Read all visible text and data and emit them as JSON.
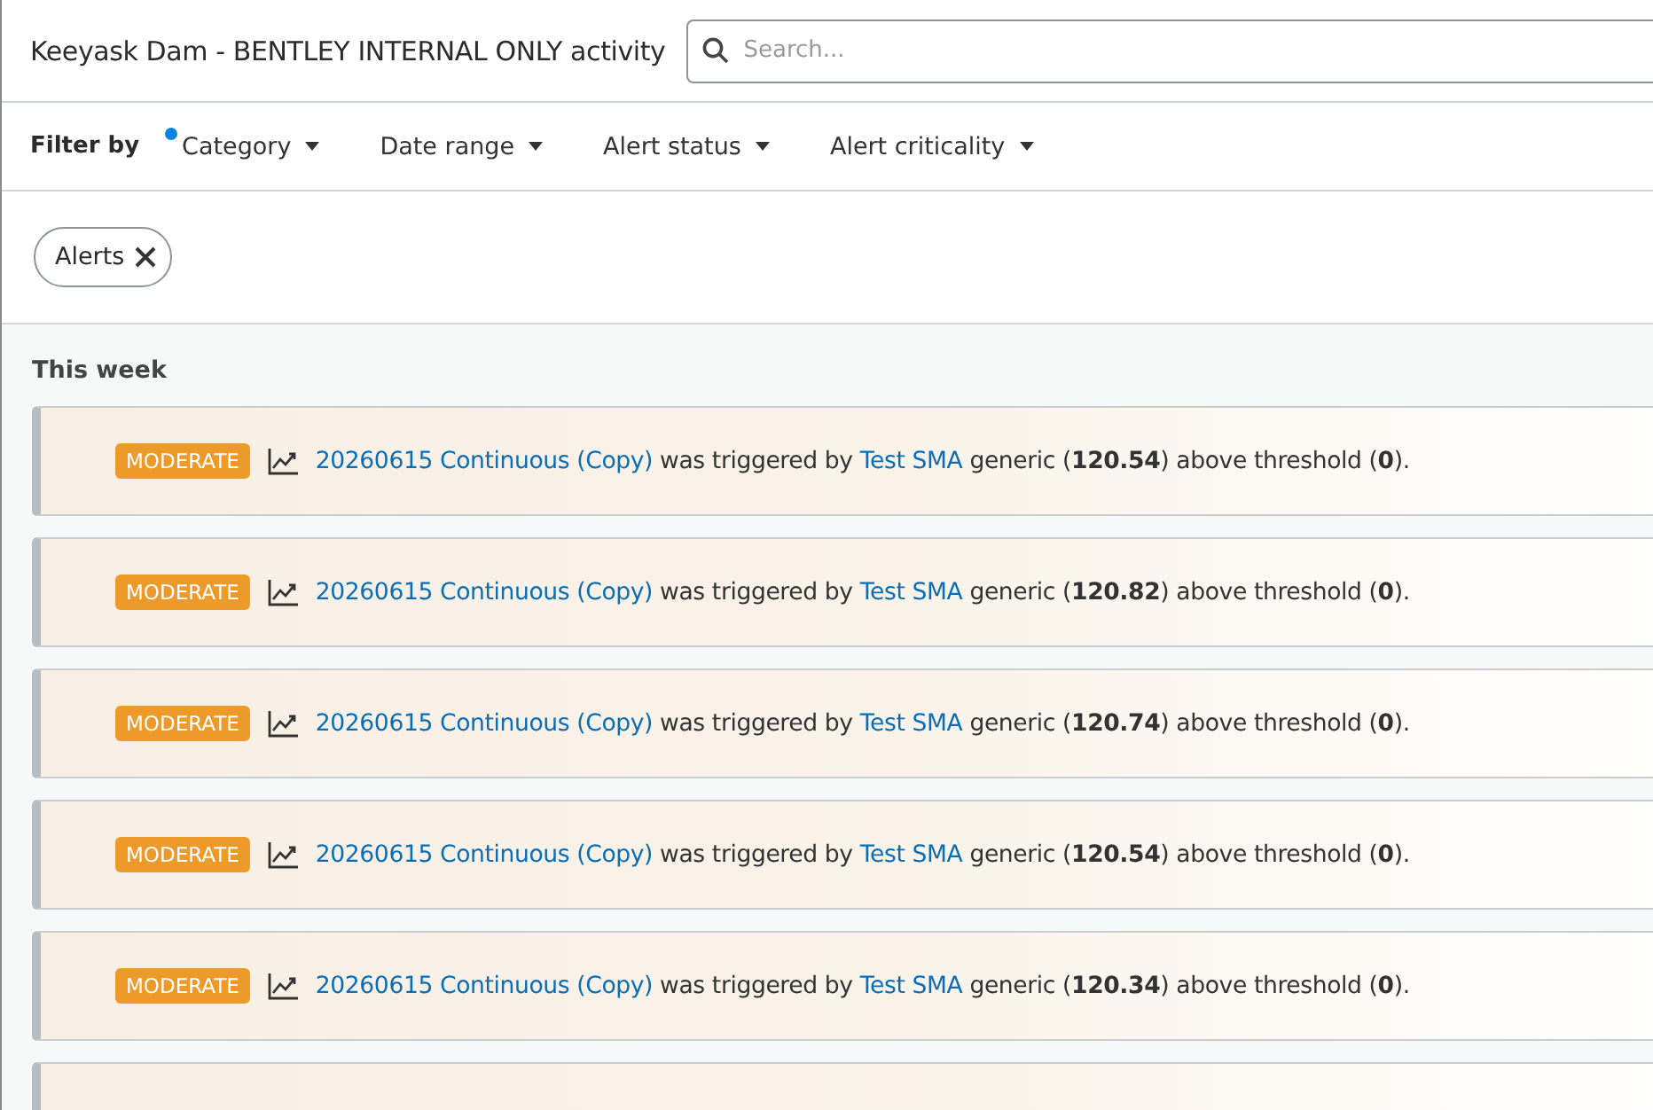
{
  "header": {
    "title": "Keeyask Dam - BENTLEY INTERNAL ONLY activity",
    "search": {
      "placeholder": "Search..."
    }
  },
  "filter_bar": {
    "label": "Filter by",
    "filters": [
      {
        "label": "Category",
        "active": true
      },
      {
        "label": "Date range",
        "active": false
      },
      {
        "label": "Alert status",
        "active": false
      },
      {
        "label": "Alert criticality",
        "active": false
      }
    ]
  },
  "chips": [
    {
      "label": "Alerts"
    }
  ],
  "section": {
    "title": "This week"
  },
  "items": [
    {
      "kind": "alert",
      "badge": "MODERATE",
      "alarm": "20260615 Continuous (Copy)",
      "middle": " was triggered by ",
      "sensor": "Test SMA",
      "tail": " generic (**120.54**) above threshold (**0**)."
    },
    {
      "kind": "alert",
      "badge": "MODERATE",
      "alarm": "20260615 Continuous (Copy)",
      "middle": " was triggered by ",
      "sensor": "Test SMA",
      "tail": " generic (**120.82**) above threshold (**0**)."
    },
    {
      "kind": "alert",
      "badge": "MODERATE",
      "alarm": "20260615 Continuous (Copy)",
      "middle": " was triggered by ",
      "sensor": "Test SMA",
      "tail": " generic (**120.74**) above threshold (**0**)."
    },
    {
      "kind": "alert",
      "badge": "MODERATE",
      "alarm": "20260615 Continuous (Copy)",
      "middle": " was triggered by ",
      "sensor": "Test SMA",
      "tail": " generic (**120.54**) above threshold (**0**)."
    },
    {
      "kind": "alert",
      "badge": "MODERATE",
      "alarm": "20260615 Continuous (Copy)",
      "middle": " was triggered by ",
      "sensor": "Test SMA",
      "tail": " generic (**120.34**) above threshold (**0**)."
    },
    {
      "kind": "cut"
    }
  ]
}
